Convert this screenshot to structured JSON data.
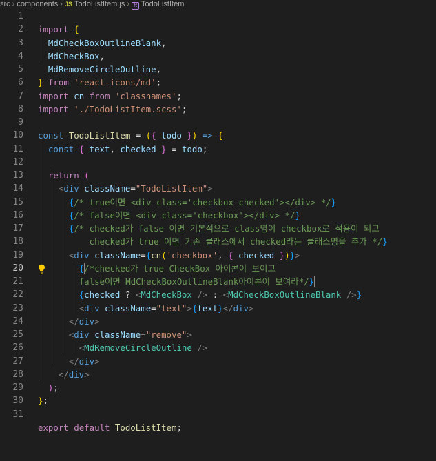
{
  "breadcrumb": {
    "parts": [
      "src",
      "components",
      "TodoListItem.js",
      "TodoListItem"
    ],
    "file_badge": "JS"
  },
  "active_line": 20,
  "line_numbers": [
    "1",
    "2",
    "3",
    "4",
    "5",
    "6",
    "7",
    "8",
    "9",
    "10",
    "11",
    "12",
    "13",
    "14",
    "15",
    "16",
    "17",
    "18",
    "19",
    "20",
    "21",
    "22",
    "23",
    "24",
    "25",
    "26",
    "27",
    "28",
    "29",
    "30",
    "31"
  ],
  "code": {
    "l1": [
      "import",
      "{"
    ],
    "l2": [
      "MdCheckBoxOutlineBlank",
      ","
    ],
    "l3": [
      "MdCheckBox",
      ","
    ],
    "l4": [
      "MdRemoveCircleOutline",
      ","
    ],
    "l5": [
      "}",
      "from",
      "'react-icons/md'",
      ";"
    ],
    "l6": [
      "import",
      "cn",
      "from",
      "'classnames'",
      ";"
    ],
    "l7": [
      "import",
      "'./TodoListItem.scss'",
      ";"
    ],
    "l9": [
      "const",
      "TodoListItem",
      "=",
      "(",
      "{",
      "todo",
      "}",
      ")",
      "=>",
      "{"
    ],
    "l10": [
      "const",
      "{",
      "text",
      ",",
      "checked",
      "}",
      "=",
      "todo",
      ";"
    ],
    "l12": [
      "return",
      "("
    ],
    "l13": [
      "<",
      "div",
      "className",
      "=",
      "\"TodoListItem\"",
      ">"
    ],
    "l14": [
      "{",
      "/* true이면 <div class='checkbox checked'></div> */",
      "}"
    ],
    "l15": [
      "{",
      "/* false이면 <div class='checkbox'></div> */",
      "}"
    ],
    "l16": [
      "{",
      "/* checked가 false 이면 기본적으로 class명이 checkbox로 적용이 되고"
    ],
    "l17": [
      "checked가 true 이면 기존 클래스에서 checked라는 클래스명을 추가 */",
      "}"
    ],
    "l18": [
      "<",
      "div",
      "className",
      "=",
      "{",
      "cn",
      "(",
      "'checkbox'",
      ",",
      "{",
      "checked",
      "}",
      ")",
      "}",
      ">"
    ],
    "l19": [
      "{",
      "/*checked가 true CheckBox 아이콘이 보이고"
    ],
    "l20": [
      "false이면 MdCheckBoxOutlineBlank아이콘이 보여라*/",
      "}"
    ],
    "l21": [
      "{",
      "checked",
      "?",
      "<",
      "MdCheckBox",
      "/>",
      ":",
      "<",
      "MdCheckBoxOutlineBlank",
      "/>",
      "}"
    ],
    "l22": [
      "<",
      "div",
      "className",
      "=",
      "\"text\"",
      ">",
      "{",
      "text",
      "}",
      "</",
      "div",
      ">"
    ],
    "l23": [
      "</",
      "div",
      ">"
    ],
    "l24": [
      "<",
      "div",
      "className",
      "=",
      "\"remove\"",
      ">"
    ],
    "l25": [
      "<",
      "MdRemoveCircleOutline",
      "/>"
    ],
    "l26": [
      "</",
      "div",
      ">"
    ],
    "l27": [
      "</",
      "div",
      ">"
    ],
    "l28": [
      ")",
      ";"
    ],
    "l29": [
      "}",
      ";"
    ],
    "l31": [
      "export",
      "default",
      "TodoListItem",
      ";"
    ]
  }
}
